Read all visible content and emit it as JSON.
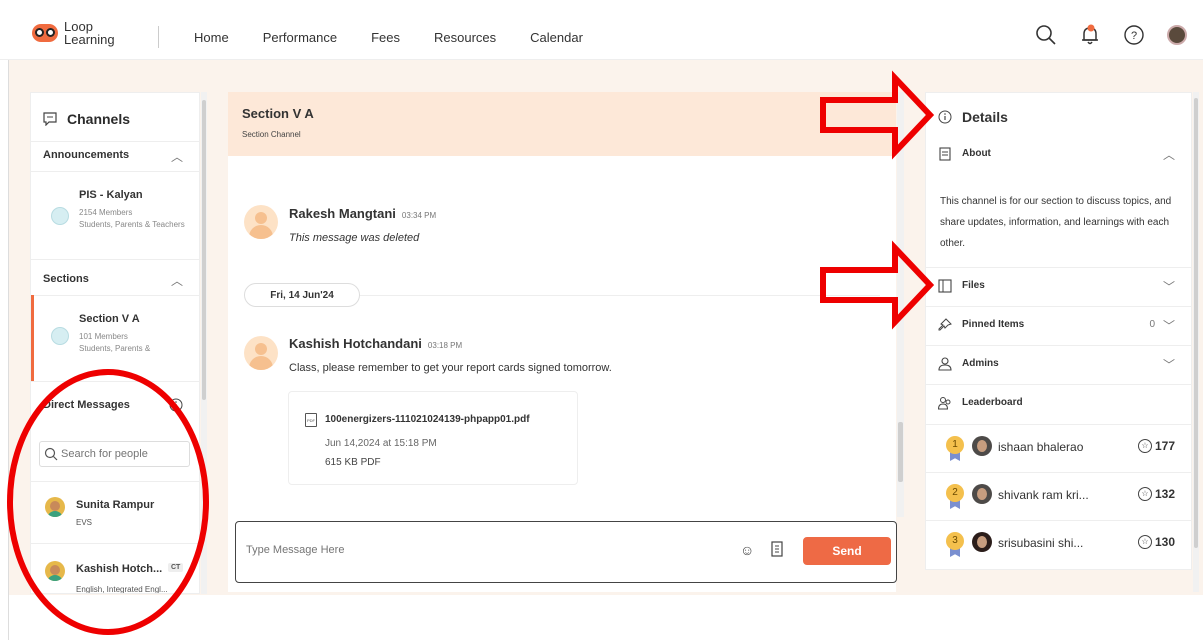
{
  "brand": {
    "line1": "Loop",
    "line2": "Learning"
  },
  "nav": [
    "Home",
    "Performance",
    "Fees",
    "Resources",
    "Calendar"
  ],
  "top_icons": [
    "search-icon",
    "bell-icon",
    "help-icon",
    "avatar"
  ],
  "channels": {
    "title": "Channels",
    "announcements": {
      "header": "Announcements",
      "items": [
        {
          "name": "PIS - Kalyan",
          "members": "2154 Members",
          "audience": "Students, Parents & Teachers"
        }
      ]
    },
    "sections": {
      "header": "Sections",
      "items": [
        {
          "name": "Section V A",
          "members": "101 Members",
          "audience": "Students, Parents &"
        }
      ]
    },
    "direct_messages": {
      "header": "Direct Messages",
      "search_placeholder": "Search for people",
      "items": [
        {
          "name": "Sunita Rampur",
          "subject": "EVS",
          "badge": ""
        },
        {
          "name": "Kashish Hotch...",
          "subject": "English, Integrated Engl...",
          "badge": "CT"
        }
      ]
    }
  },
  "chat": {
    "title": "Section V A",
    "subtitle": "Section Channel",
    "messages": [
      {
        "author": "Rakesh Mangtani",
        "time": "03:34 PM",
        "text": "This message was deleted"
      },
      {
        "author": "Kashish Hotchandani",
        "time": "03:18 PM",
        "text": "Class, please remember to get your report cards signed tomorrow."
      }
    ],
    "date_separator": "Fri, 14 Jun'24",
    "attachment": {
      "name": "100energizers-111021024139-phpapp01.pdf",
      "date": "Jun 14,2024 at 15:18 PM",
      "size": "615 KB PDF",
      "icon_label": "PDF"
    },
    "composer": {
      "placeholder": "Type Message Here",
      "send_label": "Send"
    }
  },
  "details": {
    "title": "Details",
    "about": {
      "label": "About",
      "text": "This channel is for our section to discuss topics, and share updates, information, and learnings with each other."
    },
    "files_label": "Files",
    "pinned": {
      "label": "Pinned Items",
      "count": "0"
    },
    "admins_label": "Admins",
    "leaderboard": {
      "label": "Leaderboard",
      "entries": [
        {
          "rank": "1",
          "name": "ishaan bhalerao",
          "score": "177"
        },
        {
          "rank": "2",
          "name": "shivank ram kri...",
          "score": "132"
        },
        {
          "rank": "3",
          "name": "srisubasini shi...",
          "score": "130"
        }
      ]
    }
  },
  "colors": {
    "accent": "#f06b3f",
    "send": "#ee6a45",
    "annotation": "#ee0000",
    "header_bg": "#fde8d8"
  }
}
